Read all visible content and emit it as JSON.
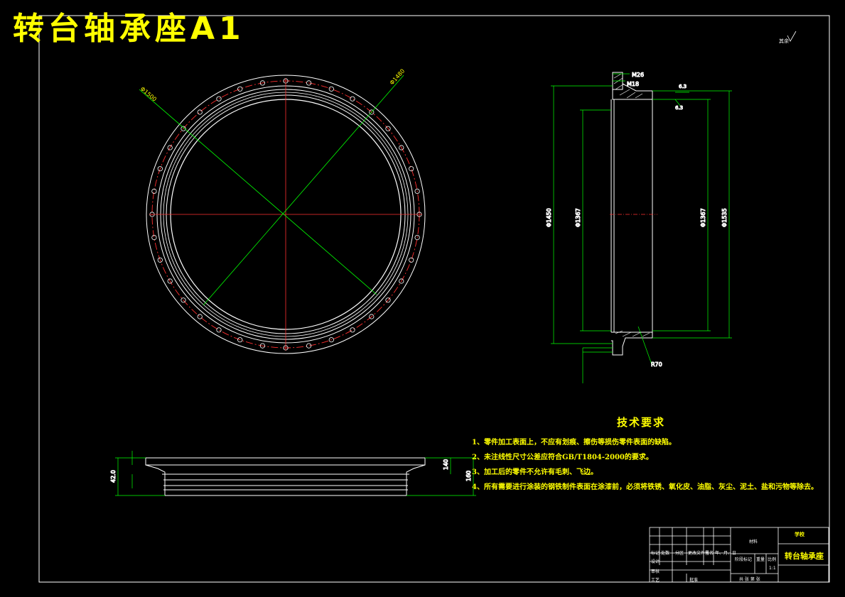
{
  "title": "转台轴承座A1",
  "tech_requirements": {
    "heading": "技术要求",
    "items": [
      "1、零件加工表面上，不应有划痕、擦伤等损伤零件表面的缺陷。",
      "2、未注线性尺寸公差应符合GB/T1804-2000的要求。",
      "3、加工后的零件不允许有毛刺、飞边。",
      "4、所有需要进行涂装的钢铁制件表面在涂漆前，必须将铁锈、氧化皮、油脂、灰尘、泥土、盐和污物等除去。"
    ]
  },
  "title_block": {
    "part_name": "转台轴承座",
    "school_label": "学校",
    "material_label": "材料",
    "scale_value": "1:1",
    "weight_label": "重量",
    "scale_label": "比例",
    "sheet_info": "共 张 第 张",
    "row_labels": [
      "标记",
      "处数",
      "分区",
      "更改文件号",
      "签名",
      "年、月、日"
    ],
    "role_labels": [
      "设计",
      "审核",
      "工艺",
      "批准"
    ],
    "stage_label": "阶段标记"
  },
  "dimensions": {
    "top_view": [
      "Φ1500",
      "Φ1480"
    ],
    "section_view": [
      "M26",
      "M18",
      "Φ1450",
      "Φ1367",
      "Φ1367",
      "Φ1535",
      "R70",
      "6.3",
      "6.3"
    ],
    "front_view": [
      "42.0",
      "140",
      "160"
    ],
    "surface_finish": "其余"
  },
  "colors": {
    "background": "#000000",
    "outline": "#ffffff",
    "dimension": "#00ff00",
    "centerline": "#ff0000",
    "text": "#ffff00"
  }
}
